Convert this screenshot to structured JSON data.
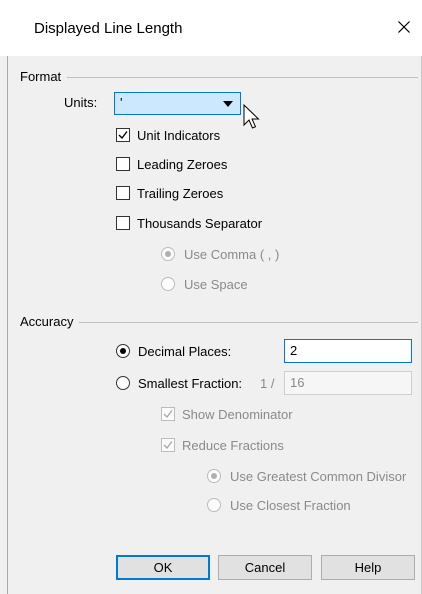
{
  "dialog": {
    "title": "Displayed Line Length"
  },
  "format": {
    "group_label": "Format",
    "units_label": "Units:",
    "units_value": "'",
    "unit_indicators": {
      "label": "Unit Indicators",
      "checked": true
    },
    "leading_zeroes": {
      "label": "Leading Zeroes",
      "checked": false
    },
    "trailing_zeroes": {
      "label": "Trailing Zeroes",
      "checked": false
    },
    "thousands_separator": {
      "label": "Thousands Separator",
      "checked": false
    },
    "use_comma": {
      "label": "Use Comma ( , )",
      "selected": true,
      "enabled": false
    },
    "use_space": {
      "label": "Use Space",
      "selected": false,
      "enabled": false
    }
  },
  "accuracy": {
    "group_label": "Accuracy",
    "decimal_places": {
      "label": "Decimal Places:",
      "selected": true,
      "value": "2"
    },
    "smallest_fraction": {
      "label": "Smallest Fraction:",
      "selected": false,
      "prefix": "1 /",
      "value": "16"
    },
    "show_denominator": {
      "label": "Show Denominator",
      "checked": true,
      "enabled": false
    },
    "reduce_fractions": {
      "label": "Reduce Fractions",
      "checked": true,
      "enabled": false
    },
    "use_gcd": {
      "label": "Use Greatest Common Divisor",
      "selected": true,
      "enabled": false
    },
    "use_closest": {
      "label": "Use Closest Fraction",
      "selected": false,
      "enabled": false
    }
  },
  "buttons": {
    "ok": "OK",
    "cancel": "Cancel",
    "help": "Help"
  },
  "colors": {
    "accent": "#0078d7",
    "select_bg": "#cce8ff",
    "button_bg": "#e1e1e1",
    "dialog_bg": "#f0f0f0"
  },
  "icons": [
    "close-icon",
    "dropdown-arrow-icon",
    "checkmark-icon",
    "mouse-cursor-icon"
  ]
}
